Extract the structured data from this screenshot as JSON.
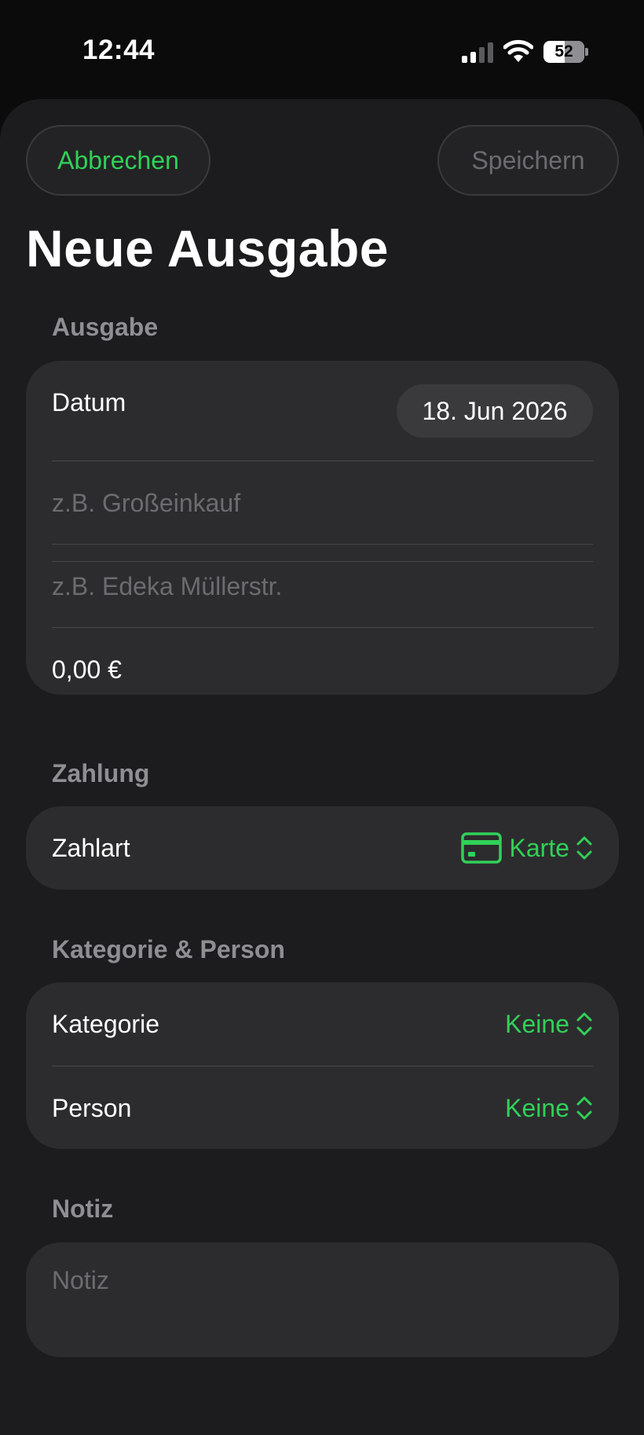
{
  "status_bar": {
    "time": "12:44",
    "battery_level": "52",
    "battery_fraction": 0.52
  },
  "toolbar": {
    "cancel_label": "Abbrechen",
    "save_label": "Speichern"
  },
  "page": {
    "title": "Neue Ausgabe"
  },
  "sections": {
    "expense": {
      "header": "Ausgabe",
      "date_label": "Datum",
      "date_value": "18. Jun 2026",
      "description_placeholder": "z.B. Großeinkauf",
      "store_placeholder": "z.B. Edeka Müllerstr.",
      "amount_value": "0,00 €"
    },
    "payment": {
      "header": "Zahlung",
      "method_label": "Zahlart",
      "method_value": "Karte",
      "method_icon": "creditcard-icon"
    },
    "category_person": {
      "header": "Kategorie & Person",
      "category_label": "Kategorie",
      "category_value": "Keine",
      "person_label": "Person",
      "person_value": "Keine"
    },
    "note": {
      "header": "Notiz",
      "placeholder": "Notiz"
    }
  },
  "colors": {
    "accent": "#30d158",
    "background": "#1c1c1e",
    "card": "#2c2c2e",
    "secondary_text": "#8e8e93",
    "placeholder": "#6c6c70"
  }
}
